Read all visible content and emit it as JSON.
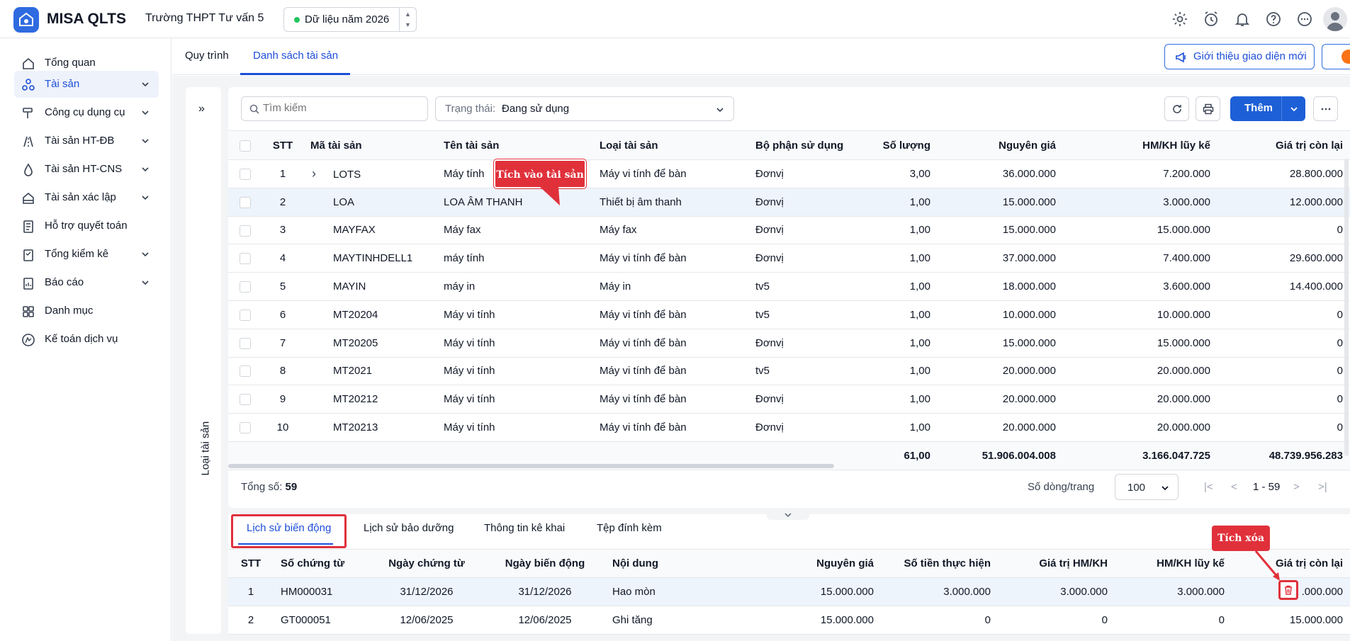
{
  "app": {
    "name": "MISA QLTS",
    "school": "Trường THPT Tư vấn 5",
    "data_year": "Dữ liệu năm 2026"
  },
  "sidebar": {
    "items": [
      {
        "label": "Tổng quan",
        "icon": "home-icon"
      },
      {
        "label": "Tài sản",
        "icon": "assets-icon"
      },
      {
        "label": "Công cụ dụng cụ",
        "icon": "tools-icon"
      },
      {
        "label": "Tài sản HT-ĐB",
        "icon": "infrastructure-icon"
      },
      {
        "label": "Tài sản HT-CNS",
        "icon": "water-icon"
      },
      {
        "label": "Tài sản xác lập",
        "icon": "established-asset-icon"
      },
      {
        "label": "Hỗ trợ quyết toán",
        "icon": "settlement-icon"
      },
      {
        "label": "Tổng kiểm kê",
        "icon": "inventory-icon"
      },
      {
        "label": "Báo cáo",
        "icon": "report-icon"
      },
      {
        "label": "Danh mục",
        "icon": "category-icon"
      },
      {
        "label": "Kế toán dịch vụ",
        "icon": "accounting-service-icon"
      }
    ]
  },
  "tabs": {
    "process": "Quy trình",
    "asset_list": "Danh sách tài sản"
  },
  "intro_button": "Giới thiệu giao diện mới",
  "left_panel_label": "Loại tài sản",
  "toolbar": {
    "search_placeholder": "Tìm kiếm",
    "status_label": "Trạng thái:",
    "status_value": "Đang sử dụng",
    "add_label": "Thêm"
  },
  "asset_table": {
    "headers": [
      "STT",
      "Mã tài sản",
      "Tên tài sản",
      "Loại tài sản",
      "Bộ phận sử dụng",
      "Số lượng",
      "Nguyên giá",
      "HM/KH lũy kế",
      "Giá trị còn lại"
    ],
    "rows": [
      {
        "stt": "1",
        "code": "LOTS",
        "name": "Máy tính",
        "type": "Máy vi tính để bàn",
        "dept": "Đơnvị",
        "qty": "3,00",
        "cost": "36.000.000",
        "dep": "7.200.000",
        "remain": "28.800.000"
      },
      {
        "stt": "2",
        "code": "LOA",
        "name": "LOA ÂM THANH",
        "type": "Thiết bị âm thanh",
        "dept": "Đơnvị",
        "qty": "1,00",
        "cost": "15.000.000",
        "dep": "3.000.000",
        "remain": "12.000.000"
      },
      {
        "stt": "3",
        "code": "MAYFAX",
        "name": "Máy fax",
        "type": "Máy fax",
        "dept": "Đơnvị",
        "qty": "1,00",
        "cost": "15.000.000",
        "dep": "15.000.000",
        "remain": "0"
      },
      {
        "stt": "4",
        "code": "MAYTINHDELL1",
        "name": "máy tính",
        "type": "Máy vi tính để bàn",
        "dept": "Đơnvị",
        "qty": "1,00",
        "cost": "37.000.000",
        "dep": "7.400.000",
        "remain": "29.600.000"
      },
      {
        "stt": "5",
        "code": "MAYIN",
        "name": "máy in",
        "type": "Máy in",
        "dept": "tv5",
        "qty": "1,00",
        "cost": "18.000.000",
        "dep": "3.600.000",
        "remain": "14.400.000"
      },
      {
        "stt": "6",
        "code": "MT20204",
        "name": "Máy vi tính",
        "type": "Máy vi tính để bàn",
        "dept": "tv5",
        "qty": "1,00",
        "cost": "10.000.000",
        "dep": "10.000.000",
        "remain": "0"
      },
      {
        "stt": "7",
        "code": "MT20205",
        "name": "Máy vi tính",
        "type": "Máy vi tính để bàn",
        "dept": "Đơnvị",
        "qty": "1,00",
        "cost": "15.000.000",
        "dep": "15.000.000",
        "remain": "0"
      },
      {
        "stt": "8",
        "code": "MT2021",
        "name": "Máy vi tính",
        "type": "Máy vi tính để bàn",
        "dept": "tv5",
        "qty": "1,00",
        "cost": "20.000.000",
        "dep": "20.000.000",
        "remain": "0"
      },
      {
        "stt": "9",
        "code": "MT20212",
        "name": "Máy vi tính",
        "type": "Máy vi tính để bàn",
        "dept": "Đơnvị",
        "qty": "1,00",
        "cost": "20.000.000",
        "dep": "20.000.000",
        "remain": "0"
      },
      {
        "stt": "10",
        "code": "MT20213",
        "name": "Máy vi tính",
        "type": "Máy vi tính để bàn",
        "dept": "Đơnvị",
        "qty": "1,00",
        "cost": "20.000.000",
        "dep": "20.000.000",
        "remain": "0"
      }
    ],
    "footer": {
      "qty": "61,00",
      "cost": "51.906.004.008",
      "dep": "3.166.047.725",
      "remain": "48.739.956.283"
    }
  },
  "paging": {
    "total_label": "Tổng số:",
    "total_value": "59",
    "rows_per_page_label": "Số dòng/trang",
    "rows_per_page": "100",
    "range": "1 - 59"
  },
  "detail_tabs": [
    "Lịch sử biến động",
    "Lịch sử bảo dưỡng",
    "Thông tin kê khai",
    "Tệp đính kèm"
  ],
  "history_table": {
    "headers": [
      "STT",
      "Số chứng từ",
      "Ngày chứng từ",
      "Ngày biến động",
      "Nội dung",
      "Nguyên giá",
      "Số tiền thực hiện",
      "Giá trị HM/KH",
      "HM/KH lũy kế",
      "Giá trị còn lại"
    ],
    "rows": [
      {
        "stt": "1",
        "doc": "HM000031",
        "doc_date": "31/12/2026",
        "change_date": "31/12/2026",
        "content": "Hao mòn",
        "cost": "15.000.000",
        "amount": "3.000.000",
        "dep_value": "3.000.000",
        "dep_acc": "3.000.000",
        "remain": ".000.000"
      },
      {
        "stt": "2",
        "doc": "GT000051",
        "doc_date": "12/06/2025",
        "change_date": "12/06/2025",
        "content": "Ghi tăng",
        "cost": "15.000.000",
        "amount": "0",
        "dep_value": "0",
        "dep_acc": "0",
        "remain": "15.000.000"
      }
    ]
  },
  "annotations": {
    "click_asset": "Tích vào tài sản",
    "click_delete": "Tích xóa"
  },
  "colors": {
    "primary": "#1d5fd6",
    "callout": "#e0313b",
    "selected_row": "#eef4fc"
  }
}
